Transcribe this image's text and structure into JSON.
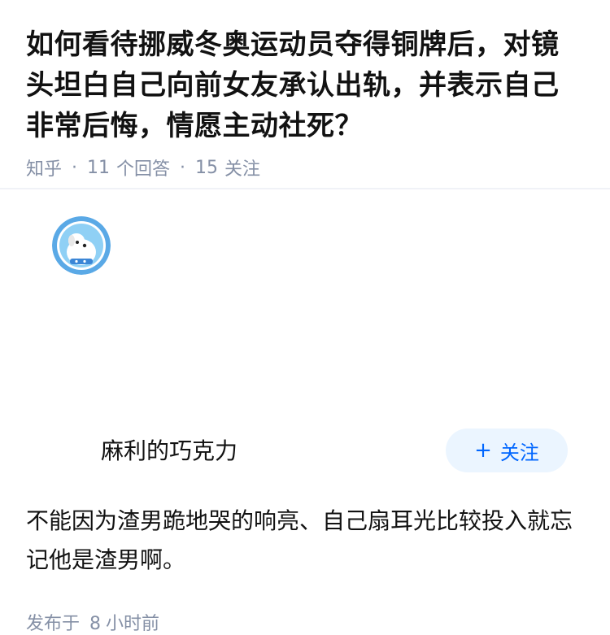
{
  "question": {
    "title": "如何看待挪威冬奥运动员夺得铜牌后，对镜头坦白自己向前女友承认出轨，并表示自己非常后悔，情愿主动社死？",
    "site": "知乎",
    "answers_count": "11",
    "answers_label": "个回答",
    "follow_count": "15",
    "follow_label": "关注"
  },
  "answer": {
    "author_name": "麻利的巧克力",
    "follow_button_label": "关注",
    "follow_button_icon": "plus-icon",
    "content": "不能因为渣男跪地哭的响亮、自己扇耳光比较投入就忘记他是渣男啊。",
    "published_prefix": "发布于",
    "published_value": "8",
    "published_unit": "小时前"
  },
  "colors": {
    "accent": "#0066ff",
    "meta": "#8590a6",
    "button_bg": "#ebf5ff",
    "avatar_bg": "#5aa9e6"
  }
}
